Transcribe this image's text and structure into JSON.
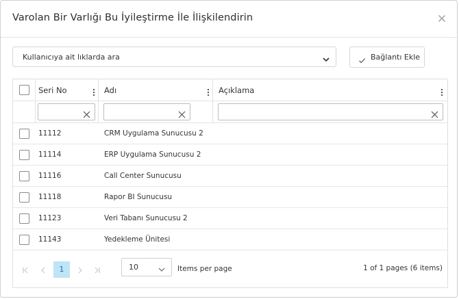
{
  "dialog": {
    "title": "Varolan Bir Varlığı Bu İyileştirme İle İlişkilendirin"
  },
  "toolbar": {
    "search_select_value": "Kullanıcıya ait lıklarda ara",
    "link_button_label": "Bağlantı Ekle"
  },
  "grid": {
    "columns": [
      {
        "key": "serial",
        "label": "Seri No"
      },
      {
        "key": "name",
        "label": "Adı"
      },
      {
        "key": "description",
        "label": "Açıklama"
      }
    ],
    "rows": [
      {
        "serial": "11112",
        "name": "CRM Uygulama Sunucusu 2",
        "description": ""
      },
      {
        "serial": "11114",
        "name": "ERP Uygulama Sunucusu 2",
        "description": ""
      },
      {
        "serial": "11116",
        "name": "Call Center Sunucusu",
        "description": ""
      },
      {
        "serial": "11118",
        "name": "Rapor BI Sunucusu",
        "description": ""
      },
      {
        "serial": "11123",
        "name": "Veri Tabanı Sunucusu 2",
        "description": ""
      },
      {
        "serial": "11143",
        "name": "Yedekleme Ünitesi",
        "description": ""
      }
    ]
  },
  "pager": {
    "current_page": "1",
    "page_size": "10",
    "items_per_page_label": "Items per page",
    "info": "1 of 1 pages (6 items)"
  },
  "colors": {
    "border": "#dedede",
    "text": "#333333",
    "accent_bg": "#bfe3f7",
    "accent_text": "#1f6fa8"
  },
  "icons": {
    "close": "close-icon",
    "dropdown": "chevron-down-icon",
    "confirm": "check-icon",
    "column_menu": "kebab-menu-icon",
    "clear_filter": "clear-icon",
    "first_page": "first-page-icon",
    "prev_page": "prev-page-icon",
    "next_page": "next-page-icon",
    "last_page": "last-page-icon"
  }
}
